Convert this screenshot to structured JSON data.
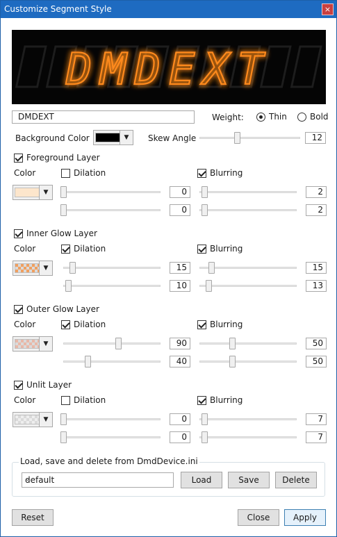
{
  "window": {
    "title": "Customize Segment Style",
    "close_glyph": "×"
  },
  "preview": {
    "text": "DMDEXT",
    "glow_color": "#ff8a1e"
  },
  "segment_text": "DMDEXT",
  "weight": {
    "label": "Weight:",
    "options": [
      {
        "label": "Thin",
        "selected": true
      },
      {
        "label": "Bold",
        "selected": false
      }
    ]
  },
  "background": {
    "label": "Background Color",
    "color": "#000000"
  },
  "skew": {
    "label": "Skew Angle",
    "value": "12",
    "level": 0.37
  },
  "common": {
    "color_label": "Color",
    "dilation_label": "Dilation",
    "blurring_label": "Blurring"
  },
  "layers": [
    {
      "name": "Foreground Layer",
      "enabled": true,
      "swatch": "#fde6cc",
      "checker": false,
      "dilation_on": false,
      "blurring_on": true,
      "dilation_values": [
        "0",
        "0"
      ],
      "blurring_values": [
        "2",
        "2"
      ],
      "dilation_levels": [
        0.0,
        0.0
      ],
      "blurring_levels": [
        0.02,
        0.02
      ]
    },
    {
      "name": "Inner Glow Layer",
      "enabled": true,
      "swatch": "#f0a060",
      "checker": true,
      "dilation_on": true,
      "blurring_on": true,
      "dilation_values": [
        "15",
        "10"
      ],
      "blurring_values": [
        "15",
        "13"
      ],
      "dilation_levels": [
        0.1,
        0.05
      ],
      "blurring_levels": [
        0.1,
        0.07
      ]
    },
    {
      "name": "Outer Glow Layer",
      "enabled": true,
      "swatch": "#e8b8a8",
      "checker": true,
      "dilation_on": true,
      "blurring_on": true,
      "dilation_values": [
        "90",
        "40"
      ],
      "blurring_values": [
        "50",
        "50"
      ],
      "dilation_levels": [
        0.6,
        0.27
      ],
      "blurring_levels": [
        0.33,
        0.33
      ]
    },
    {
      "name": "Unlit Layer",
      "enabled": true,
      "swatch": "#eeeeee",
      "checker": true,
      "dilation_on": false,
      "blurring_on": true,
      "dilation_values": [
        "0",
        "0"
      ],
      "blurring_values": [
        "7",
        "7"
      ],
      "dilation_levels": [
        0.0,
        0.0
      ],
      "blurring_levels": [
        0.02,
        0.02
      ]
    }
  ],
  "storage": {
    "legend": "Load, save and delete from DmdDevice.ini",
    "selected": "default",
    "load": "Load",
    "save": "Save",
    "delete": "Delete"
  },
  "footer": {
    "reset": "Reset",
    "close": "Close",
    "apply": "Apply"
  },
  "icons": {
    "dropdown": "▼",
    "combo_arrow": "⌄"
  }
}
